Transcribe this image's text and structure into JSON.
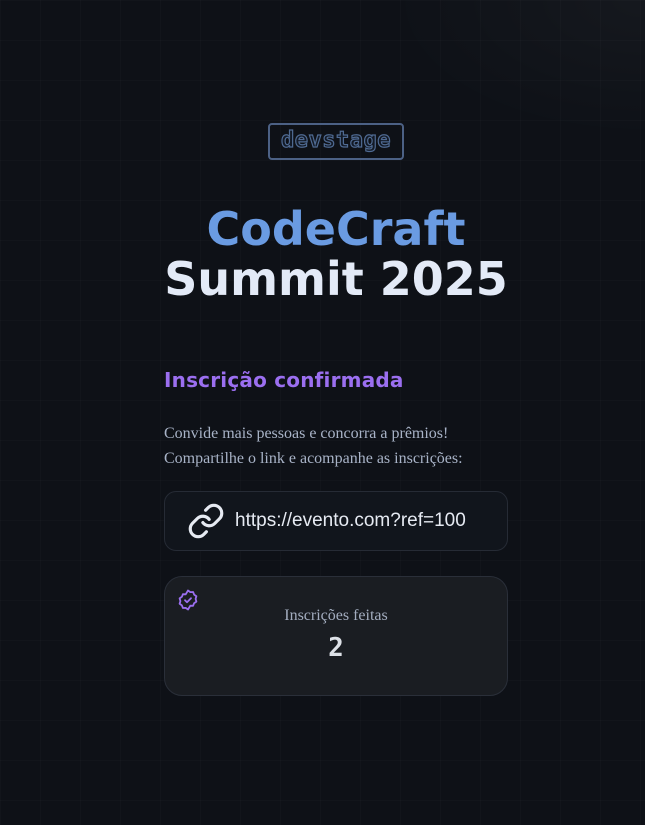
{
  "logo": {
    "text": "devstage"
  },
  "title": {
    "line1": "CodeCraft",
    "line2": "Summit 2025"
  },
  "status": {
    "heading": "Inscrição confirmada"
  },
  "description": {
    "line1": "Convide mais pessoas e concorra a prêmios!",
    "line2": "Compartilhe o link e acompanhe as inscrições:"
  },
  "invite_link": {
    "icon": "link-icon",
    "url": "https://evento.com?ref=100"
  },
  "stats": {
    "icon": "verified-badge-icon",
    "label": "Inscrições feitas",
    "value": "2"
  },
  "colors": {
    "background": "#0e1117",
    "accent_blue": "#6a9be2",
    "accent_purple": "#9b6ff0",
    "title_white": "#e3eaf7"
  }
}
